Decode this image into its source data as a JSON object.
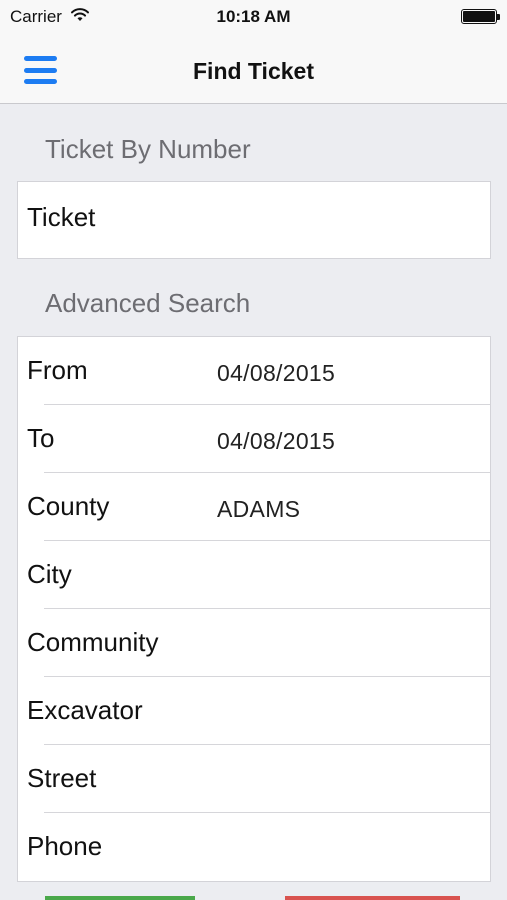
{
  "status_bar": {
    "carrier": "Carrier",
    "time": "10:18 AM",
    "wifi_icon": "wifi-icon",
    "battery_icon": "battery-icon"
  },
  "nav": {
    "title": "Find Ticket",
    "menu_icon": "hamburger-menu-icon",
    "accent_color": "#1d7cf2"
  },
  "ticket_section": {
    "header": "Ticket By Number",
    "field_label": "Ticket",
    "field_value": ""
  },
  "advanced_section": {
    "header": "Advanced Search",
    "rows": [
      {
        "label": "From",
        "value": "04/08/2015"
      },
      {
        "label": "To",
        "value": "04/08/2015"
      },
      {
        "label": "County",
        "value": "ADAMS"
      },
      {
        "label": "City",
        "value": ""
      },
      {
        "label": "Community",
        "value": ""
      },
      {
        "label": "Excavator",
        "value": ""
      },
      {
        "label": "Street",
        "value": ""
      },
      {
        "label": "Phone",
        "value": ""
      }
    ]
  },
  "bottom_buttons": {
    "colors": [
      "#4aa84a",
      "#d9534f"
    ]
  }
}
